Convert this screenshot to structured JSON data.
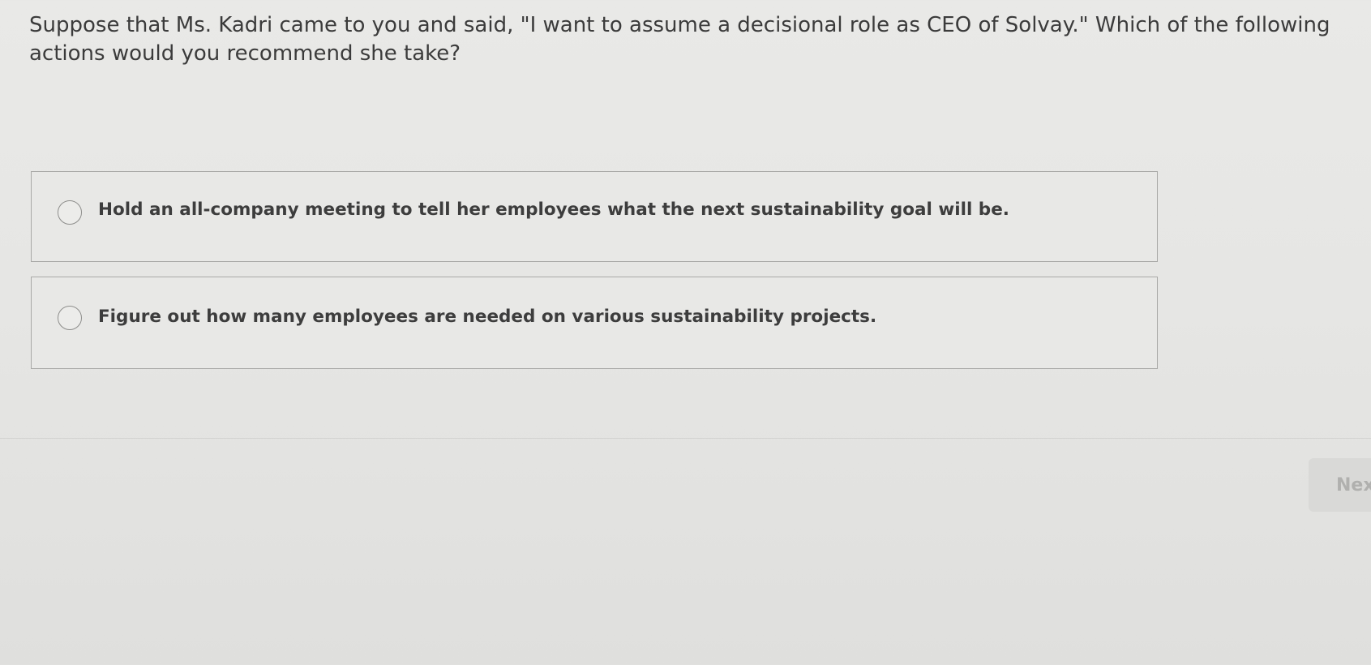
{
  "question": {
    "text": "Suppose that Ms. Kadri came to you and said, \"I want to assume a decisional role as CEO of Solvay.\" Which of the following actions would you recommend she take?"
  },
  "options": [
    {
      "label": "Hold an all-company meeting to tell her employees what the next sustainability goal will be.",
      "selected": false
    },
    {
      "label": "Figure out how many employees are needed on various sustainability projects.",
      "selected": false
    }
  ],
  "navigation": {
    "next_label": "Nex"
  }
}
